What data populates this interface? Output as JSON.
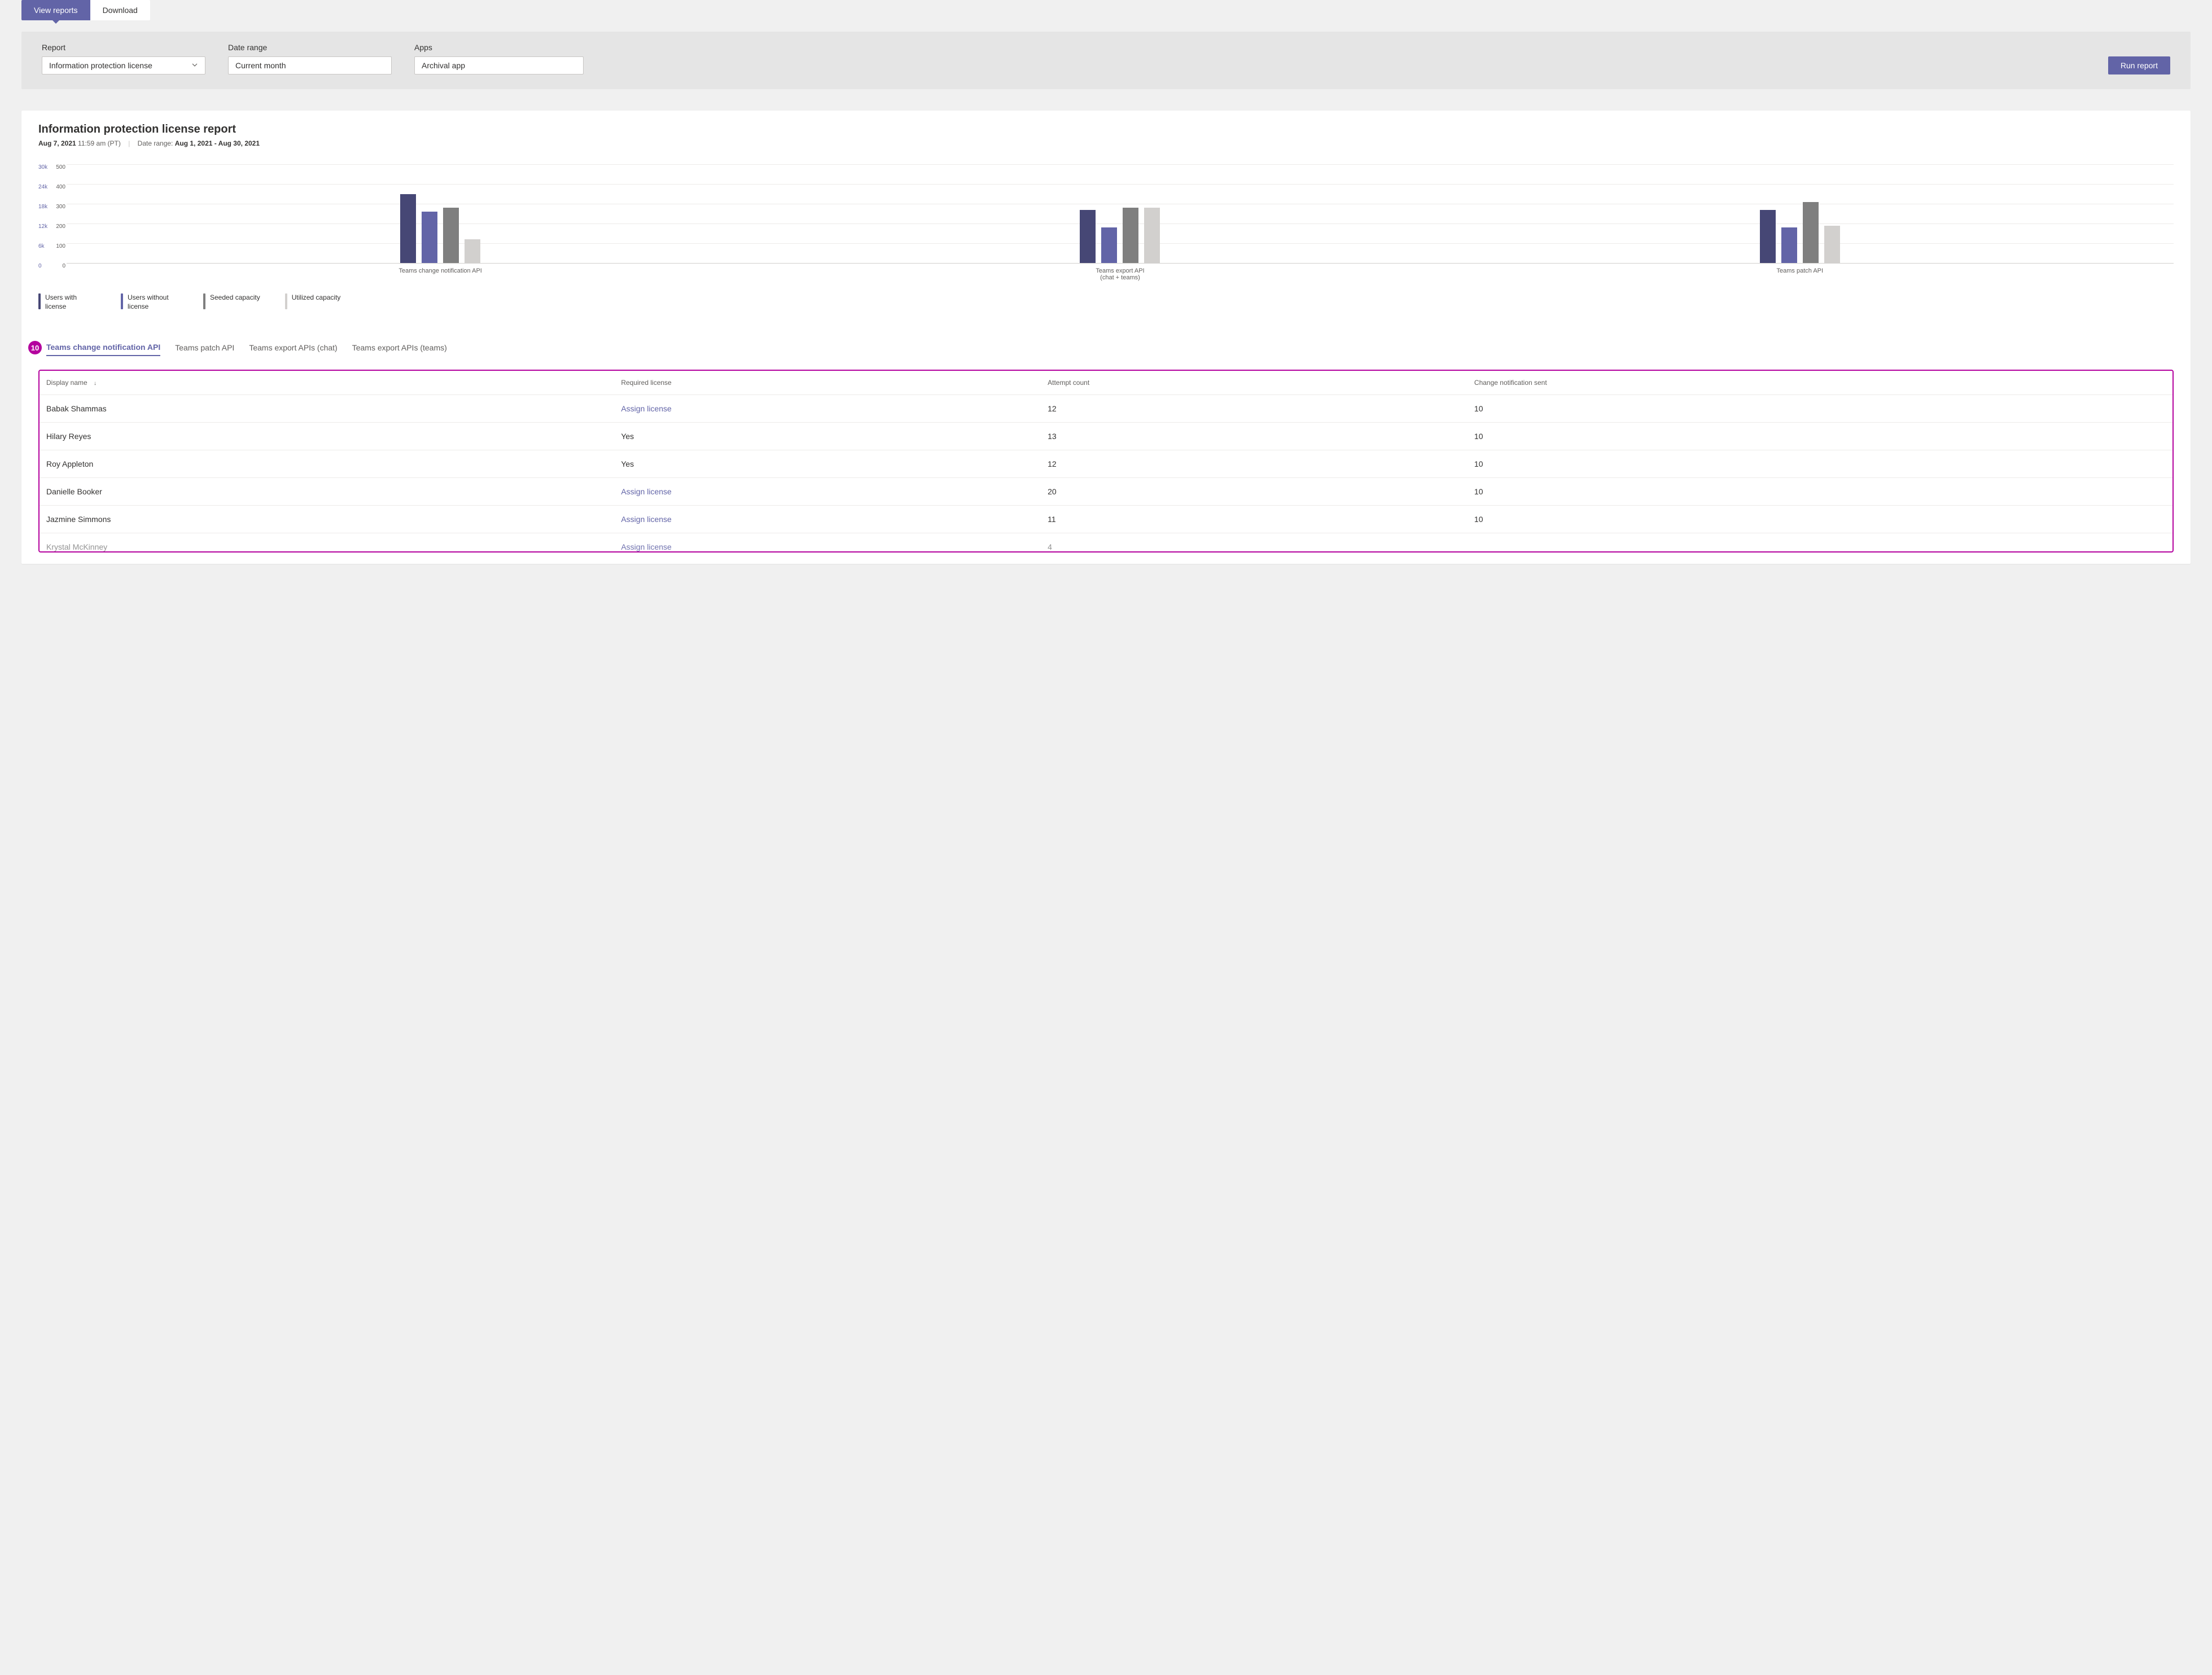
{
  "colors": {
    "primary": "#6264a7",
    "primary_dark": "#464775",
    "gray_bar": "#7f7f7f",
    "light_bar": "#d2d0ce",
    "callout": "#b4009e"
  },
  "top_tabs": {
    "view_reports": "View reports",
    "download": "Download"
  },
  "filters": {
    "report_label": "Report",
    "report_value": "Information protection license",
    "date_label": "Date range",
    "date_value": "Current month",
    "apps_label": "Apps",
    "apps_value": "Archival app",
    "run_button": "Run report"
  },
  "report": {
    "title": "Information protection license report",
    "timestamp_date": "Aug 7, 2021",
    "timestamp_time": "11:59 am (PT)",
    "date_range_label": "Date range:",
    "date_range_value": "Aug 1, 2021 - Aug 30, 2021"
  },
  "chart_data": {
    "type": "bar",
    "y_left": {
      "max": 30000,
      "ticks": [
        "30k",
        "24k",
        "18k",
        "12k",
        "6k",
        "0"
      ]
    },
    "y_right": {
      "max": 500,
      "ticks": [
        "500",
        "400",
        "300",
        "200",
        "100",
        "0"
      ]
    },
    "categories": [
      "Teams change notification API",
      "Teams export API\n(chat + teams)",
      "Teams patch API"
    ],
    "series": [
      {
        "name": "Users with license",
        "color": "#464775",
        "values": [
          350,
          270,
          270
        ]
      },
      {
        "name": "Users without license",
        "color": "#6264a7",
        "values": [
          260,
          180,
          180
        ]
      },
      {
        "name": "Seeded capacity",
        "color": "#7f7f7f",
        "values": [
          280,
          280,
          310
        ]
      },
      {
        "name": "Utilized capacity",
        "color": "#d2d0ce",
        "values": [
          120,
          280,
          190
        ]
      }
    ],
    "y_max_for_bars": 500
  },
  "legend": {
    "users_with": "Users with license",
    "users_without": "Users without license",
    "seeded": "Seeded capacity",
    "utilized": "Utilized capacity"
  },
  "callout_badge": "10",
  "sub_tabs": {
    "change": "Teams change notification API",
    "patch": "Teams patch API",
    "export_chat": "Teams export APIs (chat)",
    "export_teams": "Teams export APIs (teams)"
  },
  "table": {
    "headers": {
      "display_name": "Display name",
      "required_license": "Required license",
      "attempt_count": "Attempt count",
      "change_sent": "Change notification sent"
    },
    "assign_license_label": "Assign license",
    "yes_label": "Yes",
    "rows": [
      {
        "name": "Babak Shammas",
        "license": "assign",
        "attempts": "12",
        "sent": "10"
      },
      {
        "name": "Hilary Reyes",
        "license": "yes",
        "attempts": "13",
        "sent": "10"
      },
      {
        "name": "Roy Appleton",
        "license": "yes",
        "attempts": "12",
        "sent": "10"
      },
      {
        "name": "Danielle Booker",
        "license": "assign",
        "attempts": "20",
        "sent": "10"
      },
      {
        "name": "Jazmine Simmons",
        "license": "assign",
        "attempts": "11",
        "sent": "10"
      },
      {
        "name": "Krystal McKinney",
        "license": "assign",
        "attempts": "4",
        "sent": ""
      }
    ]
  }
}
